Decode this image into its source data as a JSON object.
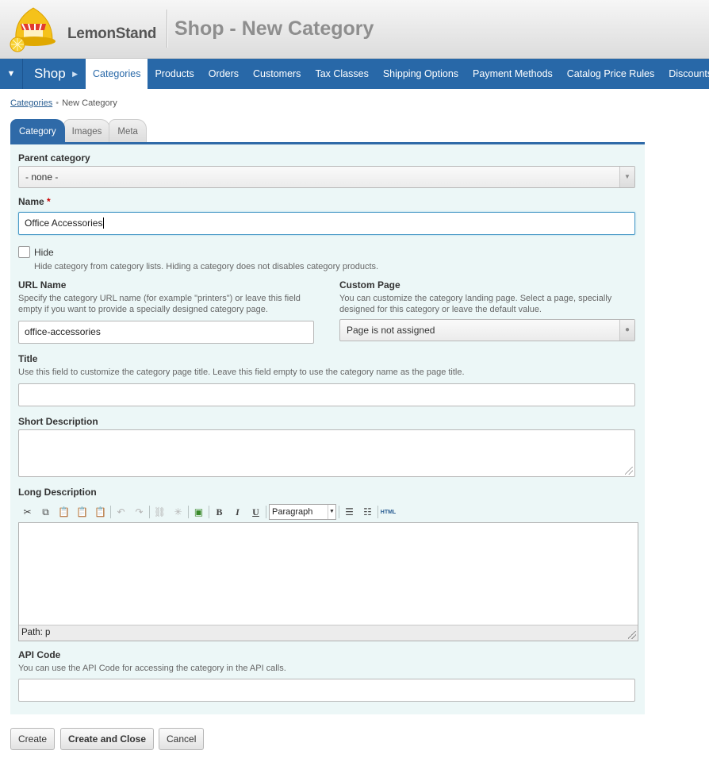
{
  "header": {
    "logo_text": "LemonStand",
    "page_title": "Shop - New Category"
  },
  "nav": {
    "toggle_icon": "menu-caret-down-icon",
    "section": "Shop",
    "items": [
      {
        "label": "Categories",
        "active": true
      },
      {
        "label": "Products"
      },
      {
        "label": "Orders"
      },
      {
        "label": "Customers"
      },
      {
        "label": "Tax Classes"
      },
      {
        "label": "Shipping Options"
      },
      {
        "label": "Payment Methods"
      },
      {
        "label": "Catalog Price Rules"
      },
      {
        "label": "Discounts"
      }
    ]
  },
  "breadcrumb": {
    "link": "Categories",
    "current": "New Category"
  },
  "tabs": [
    {
      "label": "Category",
      "active": true
    },
    {
      "label": "Images"
    },
    {
      "label": "Meta"
    }
  ],
  "form": {
    "parent_category": {
      "label": "Parent category",
      "value": "- none -"
    },
    "name": {
      "label": "Name",
      "required_mark": "*",
      "value": "Office Accessories"
    },
    "hide": {
      "label": "Hide",
      "hint": "Hide category from category lists. Hiding a category does not disables category products.",
      "checked": false
    },
    "url_name": {
      "label": "URL Name",
      "hint": "Specify the category URL name (for example \"printers\") or leave this field empty if you want to provide a specially designed category page.",
      "value": "office-accessories"
    },
    "custom_page": {
      "label": "Custom Page",
      "hint": "You can customize the category landing page. Select a page, specially designed for this category or leave the default value.",
      "value": "Page is not assigned"
    },
    "title": {
      "label": "Title",
      "hint": "Use this field to customize the category page title. Leave this field empty to use the category name as the page title.",
      "value": ""
    },
    "short_description": {
      "label": "Short Description",
      "value": ""
    },
    "long_description": {
      "label": "Long Description",
      "format": "Paragraph",
      "path": "Path: p",
      "toolbar_icons": [
        "cut-icon",
        "copy-icon",
        "paste-icon",
        "paste-text-icon",
        "paste-word-icon",
        "undo-icon",
        "redo-icon",
        "link-icon",
        "unlink-icon",
        "image-icon",
        "bold-icon",
        "italic-icon",
        "underline-icon",
        "bullet-list-icon",
        "numbered-list-icon",
        "html-source-icon"
      ]
    },
    "api_code": {
      "label": "API Code",
      "hint": "You can use the API Code for accessing the category in the API calls.",
      "value": ""
    }
  },
  "buttons": {
    "create": "Create",
    "create_close": "Create and Close",
    "cancel": "Cancel"
  },
  "colors": {
    "nav_blue": "#2868a8",
    "panel_bg": "#ecf7f7",
    "required": "#cc0000"
  }
}
